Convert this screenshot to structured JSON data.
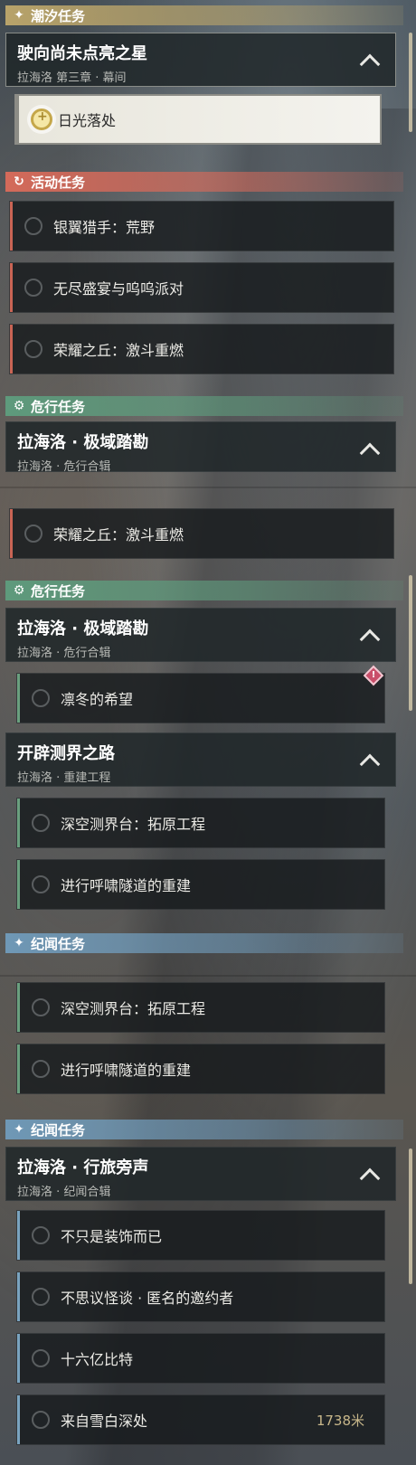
{
  "panels": {
    "p1": {
      "tide_header": "潮汐任务",
      "tide_group": {
        "title": "驶向尚未点亮之星",
        "sub": "拉海洛 第三章 · 幕间"
      },
      "tide_task": "日光落处",
      "event_header": "活动任务",
      "event_tasks": [
        "银翼猎手：荒野",
        "无尽盛宴与呜呜派对",
        "荣耀之丘：激斗重燃"
      ],
      "danger_header": "危行任务",
      "danger_group": {
        "title": "拉海洛 · 极域踏勘",
        "sub": "拉海洛 · 危行合辑"
      }
    },
    "p2": {
      "event_task": "荣耀之丘：激斗重燃",
      "danger_header": "危行任务",
      "danger_group": {
        "title": "拉海洛 · 极域踏勘",
        "sub": "拉海洛 · 危行合辑"
      },
      "danger_task": "凛冬的希望",
      "rebuild_group": {
        "title": "开辟测界之路",
        "sub": "拉海洛 · 重建工程"
      },
      "rebuild_tasks": [
        "深空测界台：拓原工程",
        "进行呼啸隧道的重建"
      ],
      "story_header": "纪闻任务"
    },
    "p3": {
      "rebuild_tasks": [
        "深空测界台：拓原工程",
        "进行呼啸隧道的重建"
      ],
      "story_header": "纪闻任务",
      "story_group": {
        "title": "拉海洛 · 行旅旁声",
        "sub": "拉海洛 · 纪闻合辑"
      },
      "story_tasks": [
        "不只是装饰而已",
        "不思议怪谈 · 匿名的邀约者",
        "十六亿比特",
        "来自雪白深处"
      ],
      "distance": "1738米"
    }
  },
  "icons": {
    "tide": "sparkle-icon",
    "event": "refresh-icon",
    "danger": "gear-icon",
    "story": "sparkle-icon",
    "selected": "sun-icon",
    "alert": "warning-icon"
  },
  "colors": {
    "tide": "#b8a36a",
    "event": "#d46a5a",
    "danger": "#5e9a7c",
    "story": "#6f98b6"
  }
}
